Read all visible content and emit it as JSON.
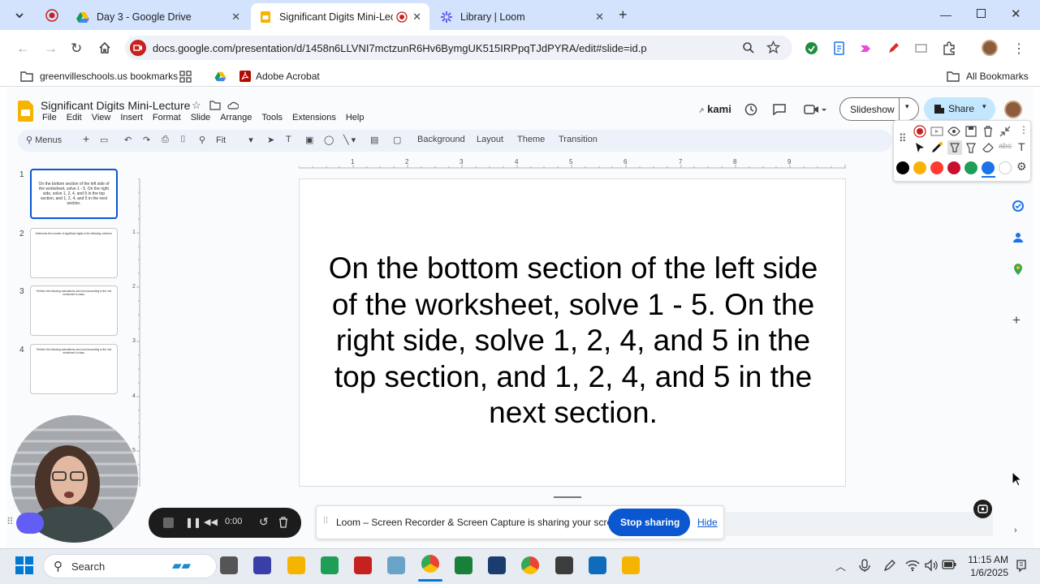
{
  "browser": {
    "tabs": [
      {
        "title": "Day 3 - Google Drive",
        "active": false
      },
      {
        "title": "Significant Digits Mini-Lectu",
        "active": true
      },
      {
        "title": "Library | Loom",
        "active": false
      }
    ],
    "url": "docs.google.com/presentation/d/1458n6LLVNI7mctzunR6Hv6BymgUK515IRPpqTJdPYRA/edit#slide=id.p",
    "bookmarks": [
      {
        "label": "greenvilleschools.us bookmarks",
        "icon": "folder-icon"
      },
      {
        "label": "Adobe Acrobat",
        "icon": "acrobat-icon"
      },
      {
        "label": "All Bookmarks",
        "icon": "folder-icon"
      }
    ]
  },
  "slides": {
    "doc_title": "Significant Digits Mini-Lecture",
    "menu": [
      "File",
      "Edit",
      "View",
      "Insert",
      "Format",
      "Slide",
      "Arrange",
      "Tools",
      "Extensions",
      "Help"
    ],
    "kami_label": "kami",
    "slideshow_label": "Slideshow",
    "share_label": "Share",
    "toolbar": {
      "menus_label": "Menus",
      "zoom_label": "Fit",
      "background_label": "Background",
      "layout_label": "Layout",
      "theme_label": "Theme",
      "transition_label": "Transition"
    },
    "ruler_top": [
      "1",
      "2",
      "3",
      "4",
      "5",
      "6",
      "7",
      "8",
      "9"
    ],
    "ruler_left": [
      "1",
      "2",
      "3",
      "4",
      "5"
    ],
    "thumbnails": [
      {
        "num": "1",
        "text": "On the bottom section of the left side of the worksheet, solve 1 - 5.  On the right side, solve  1, 2, 4, and 5 in the top section, and 1, 2, 4, and 5 in the next section."
      },
      {
        "num": "2",
        "text": "Determine the number of significant digits in the following numbers."
      },
      {
        "num": "3",
        "text": "Perform the following calculations and round according to the rule mentioned in class."
      },
      {
        "num": "4",
        "text": "Perform the following calculations and round according to the rule mentioned in class."
      }
    ],
    "slide_text": "On the bottom section of the left side\nof the worksheet, solve 1 - 5.  On the\nright side, solve  1, 2, 4, and 5 in the\ntop section, and 1, 2, 4, and 5 in the\nnext section."
  },
  "kami_colors": [
    "#000000",
    "#f9b208",
    "#ff3b30",
    "#c8102e",
    "#1e9e57",
    "#1a73e8",
    "#ffffff"
  ],
  "loom": {
    "sharing_text": "Loom – Screen Recorder & Screen Capture is sharing your screen.",
    "stop_label": "Stop sharing",
    "hide_label": "Hide",
    "timer": "0:00"
  },
  "taskbar": {
    "search_label": "Search",
    "time": "11:15 AM",
    "date": "1/6/2025"
  }
}
